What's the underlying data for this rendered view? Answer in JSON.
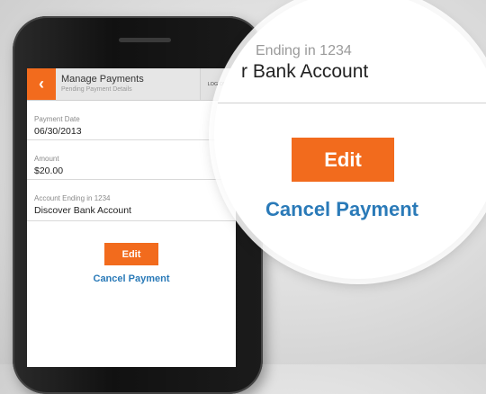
{
  "app": {
    "title": "Manage Payments",
    "subtitle": "Pending Payment Details",
    "logout_label": "LOG OUT",
    "back_glyph": "‹"
  },
  "fields": [
    {
      "label": "Payment Date",
      "value": "06/30/2013"
    },
    {
      "label": "Amount",
      "value": "$20.00"
    },
    {
      "label": "Account Ending in 1234",
      "value": "Discover Bank Account"
    }
  ],
  "actions": {
    "edit_label": "Edit",
    "cancel_label": "Cancel Payment"
  },
  "magnifier": {
    "account_sub": "Ending in 1234",
    "account_value": "r Bank Account",
    "edit_label": "Edit",
    "cancel_label": "Cancel Payment"
  },
  "colors": {
    "accent": "#f26b1d",
    "link": "#2a7ab8"
  }
}
